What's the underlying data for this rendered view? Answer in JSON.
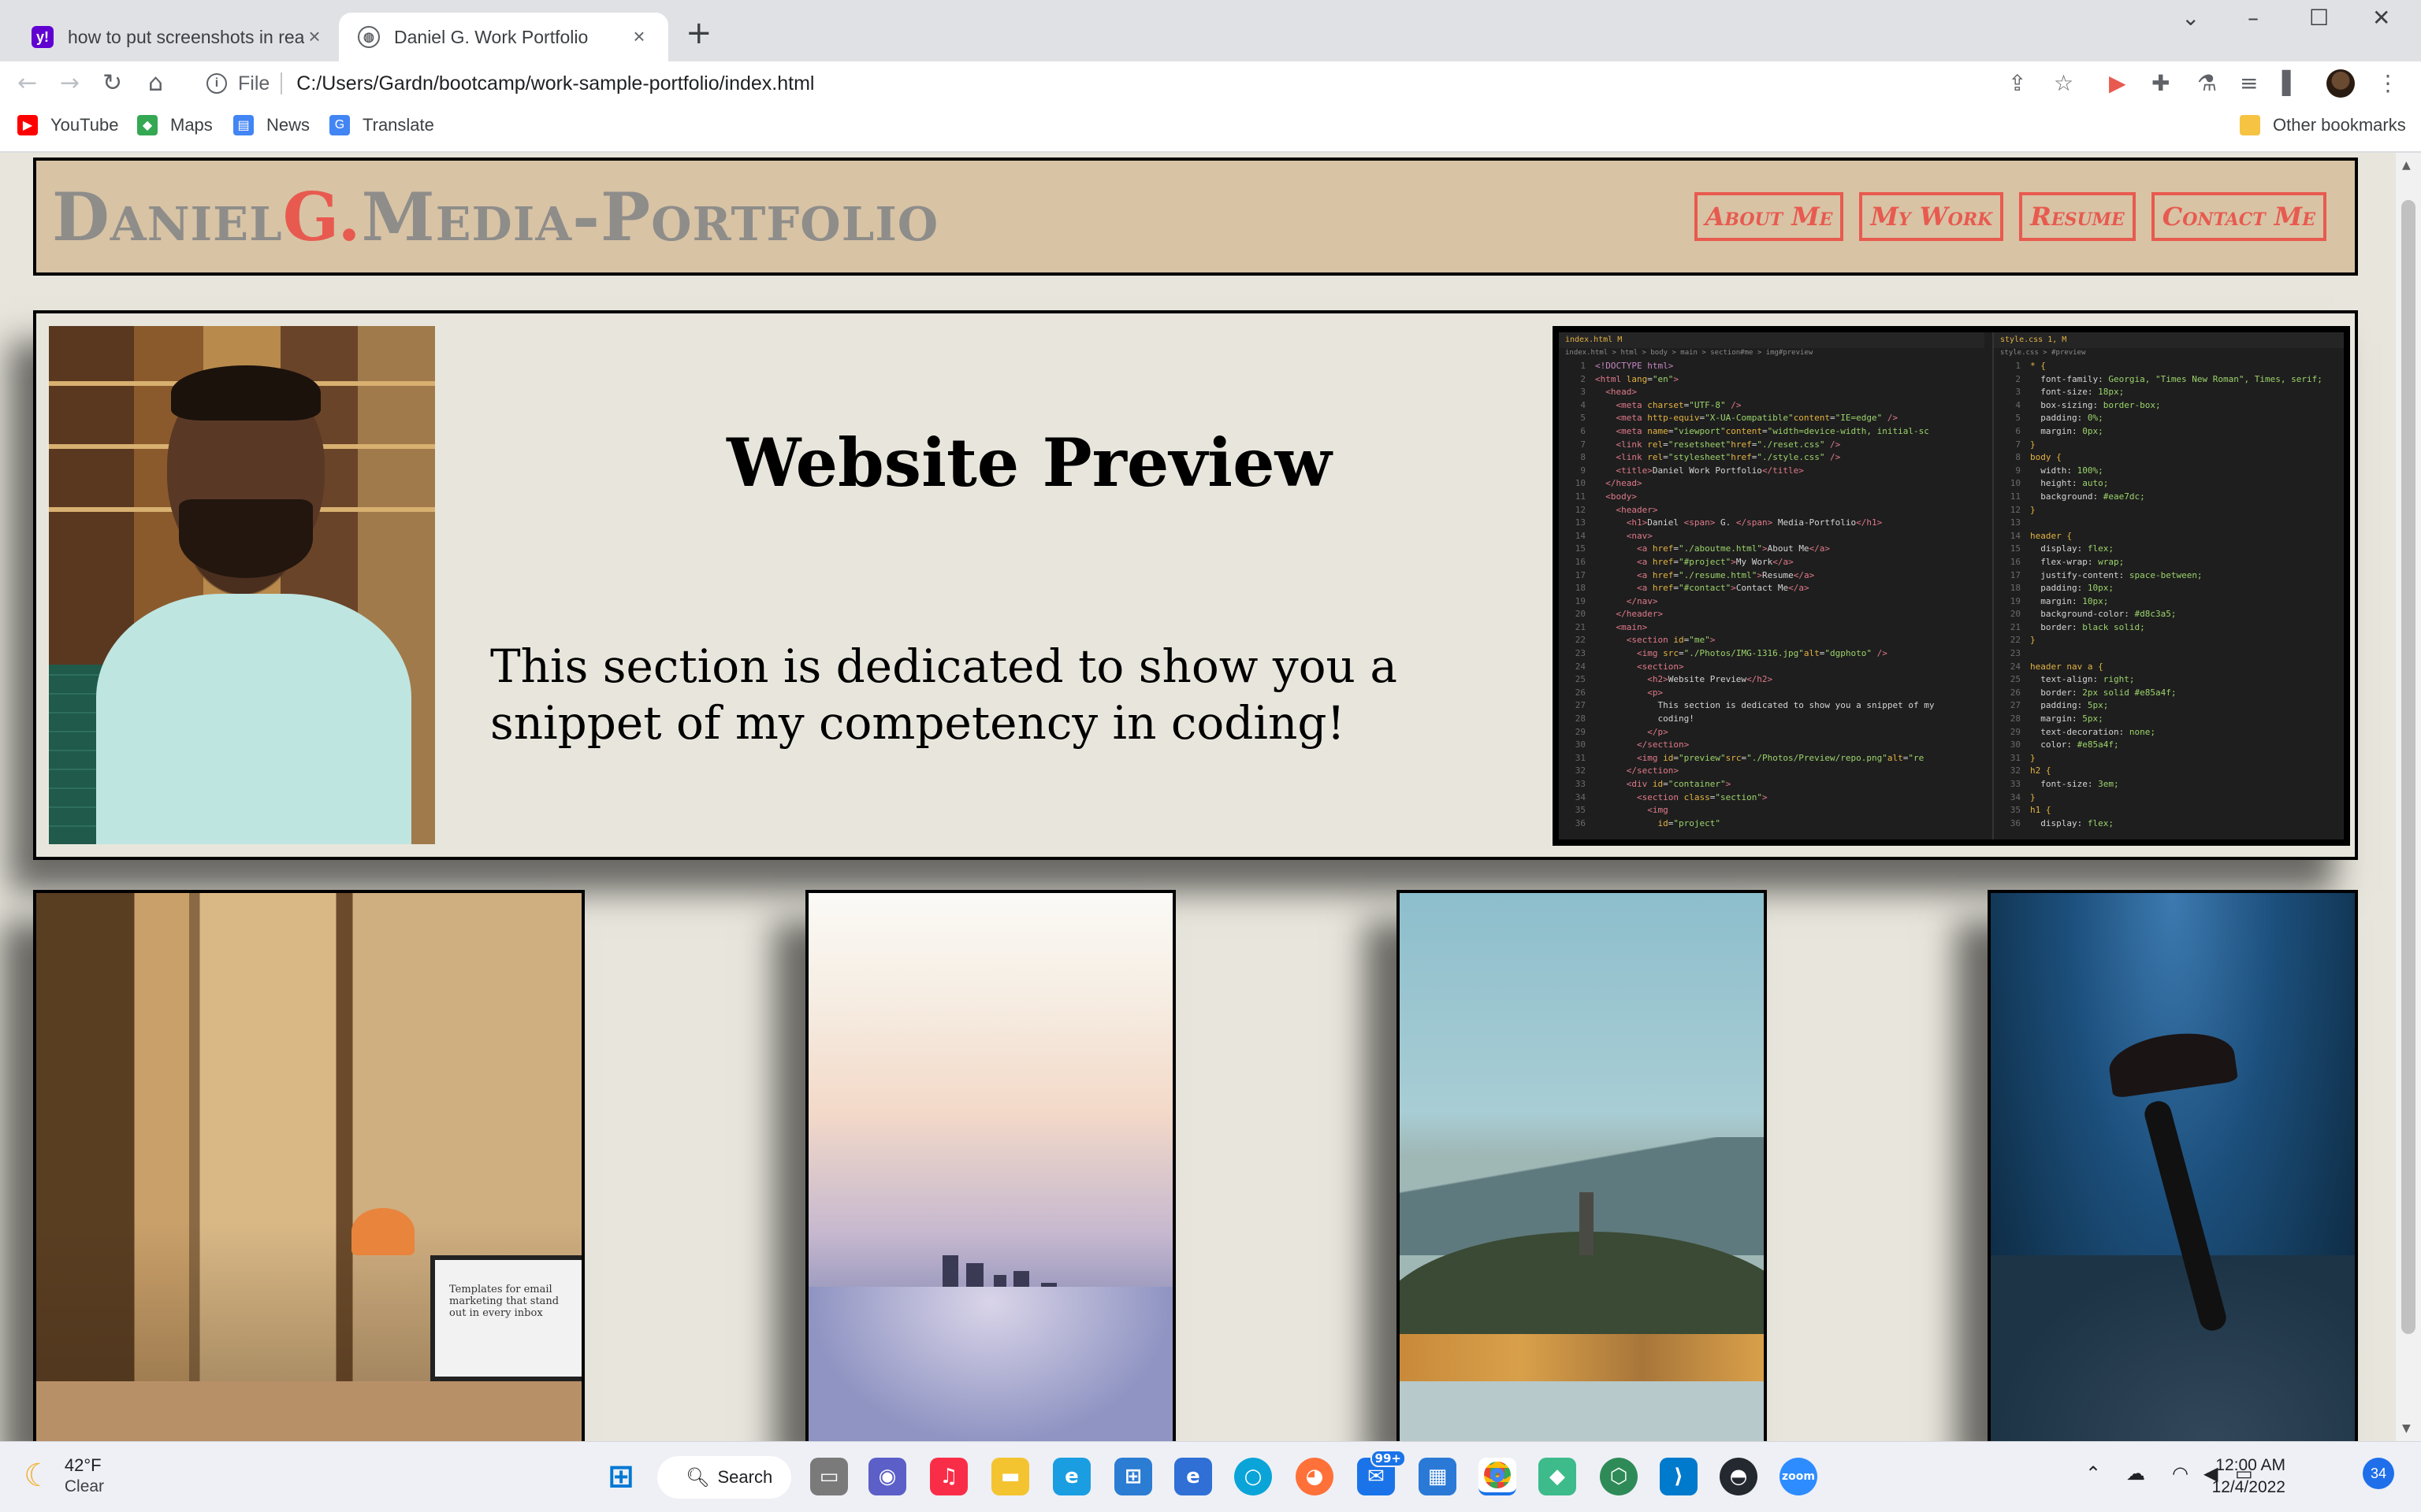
{
  "browser": {
    "tabs": [
      {
        "title": "how to put screenshots in readme",
        "active": false
      },
      {
        "title": "Daniel G. Work Portfolio",
        "active": true
      }
    ],
    "address": {
      "scheme": "File",
      "url": "C:/Users/Gardn/bootcamp/work-sample-portfolio/index.html"
    },
    "bookmarks": [
      "YouTube",
      "Maps",
      "News",
      "Translate"
    ],
    "other_bookmarks": "Other bookmarks"
  },
  "site": {
    "title_first": "Daniel",
    "title_mid": "G.",
    "title_last": "Media-Portfolio",
    "nav": [
      "About Me",
      "My Work",
      "Resume",
      "Contact Me"
    ],
    "section_title": "Website Preview",
    "section_text": "This section is dedicated to show you a snippet of my competency in coding!"
  },
  "editor": {
    "left_tab": "index.html M",
    "left_crumbs": "index.html > html > body > main > section#me > img#preview",
    "right_tab": "style.css 1, M",
    "right_crumbs": "style.css > #preview"
  },
  "gallery": {
    "monitor_text": "Templates for email marketing that stand out in every inbox"
  },
  "taskbar": {
    "temp": "42°F",
    "condition": "Clear",
    "search": "Search",
    "mail_badge": "99+",
    "time": "12:00 AM",
    "date": "12/4/2022",
    "notifications": "34"
  },
  "colors": {
    "header_bg": "#d8c3a5",
    "accent": "#e85a4f",
    "title_gray": "#8e8d8a",
    "page_bg": "#e8e6dc"
  }
}
